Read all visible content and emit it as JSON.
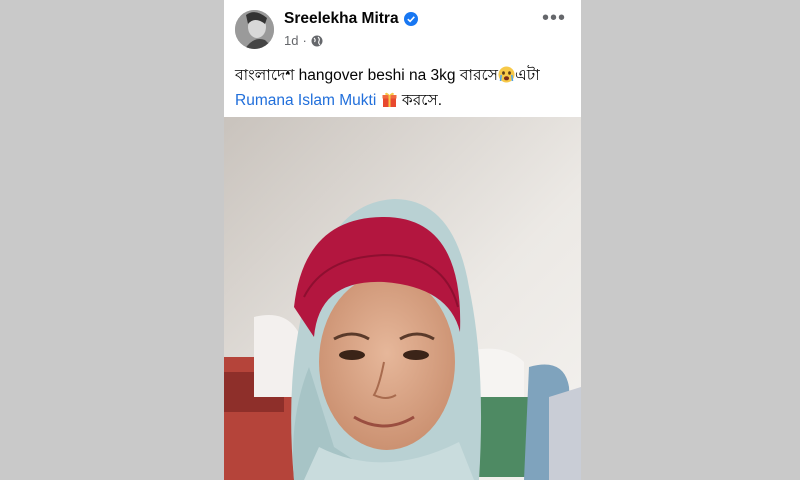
{
  "post": {
    "author": "Sreelekha Mitra",
    "time": "1d",
    "more_label": "•••",
    "text_part1": "বাংলাদেশ hangover beshi na 3kg বারসে",
    "text_part2": "এটা",
    "mention": "Rumana Islam Mukti",
    "text_part3": " করসে.",
    "emoji_1": "crying-face",
    "emoji_2": "gift",
    "privacy_icon": "globe-icon",
    "verified_icon": "verified-badge-icon"
  },
  "colors": {
    "background": "#c9c9c9",
    "card": "#ffffff",
    "mention": "#216fdb",
    "secondary_text": "#65676b",
    "verified": "#1877f2"
  }
}
